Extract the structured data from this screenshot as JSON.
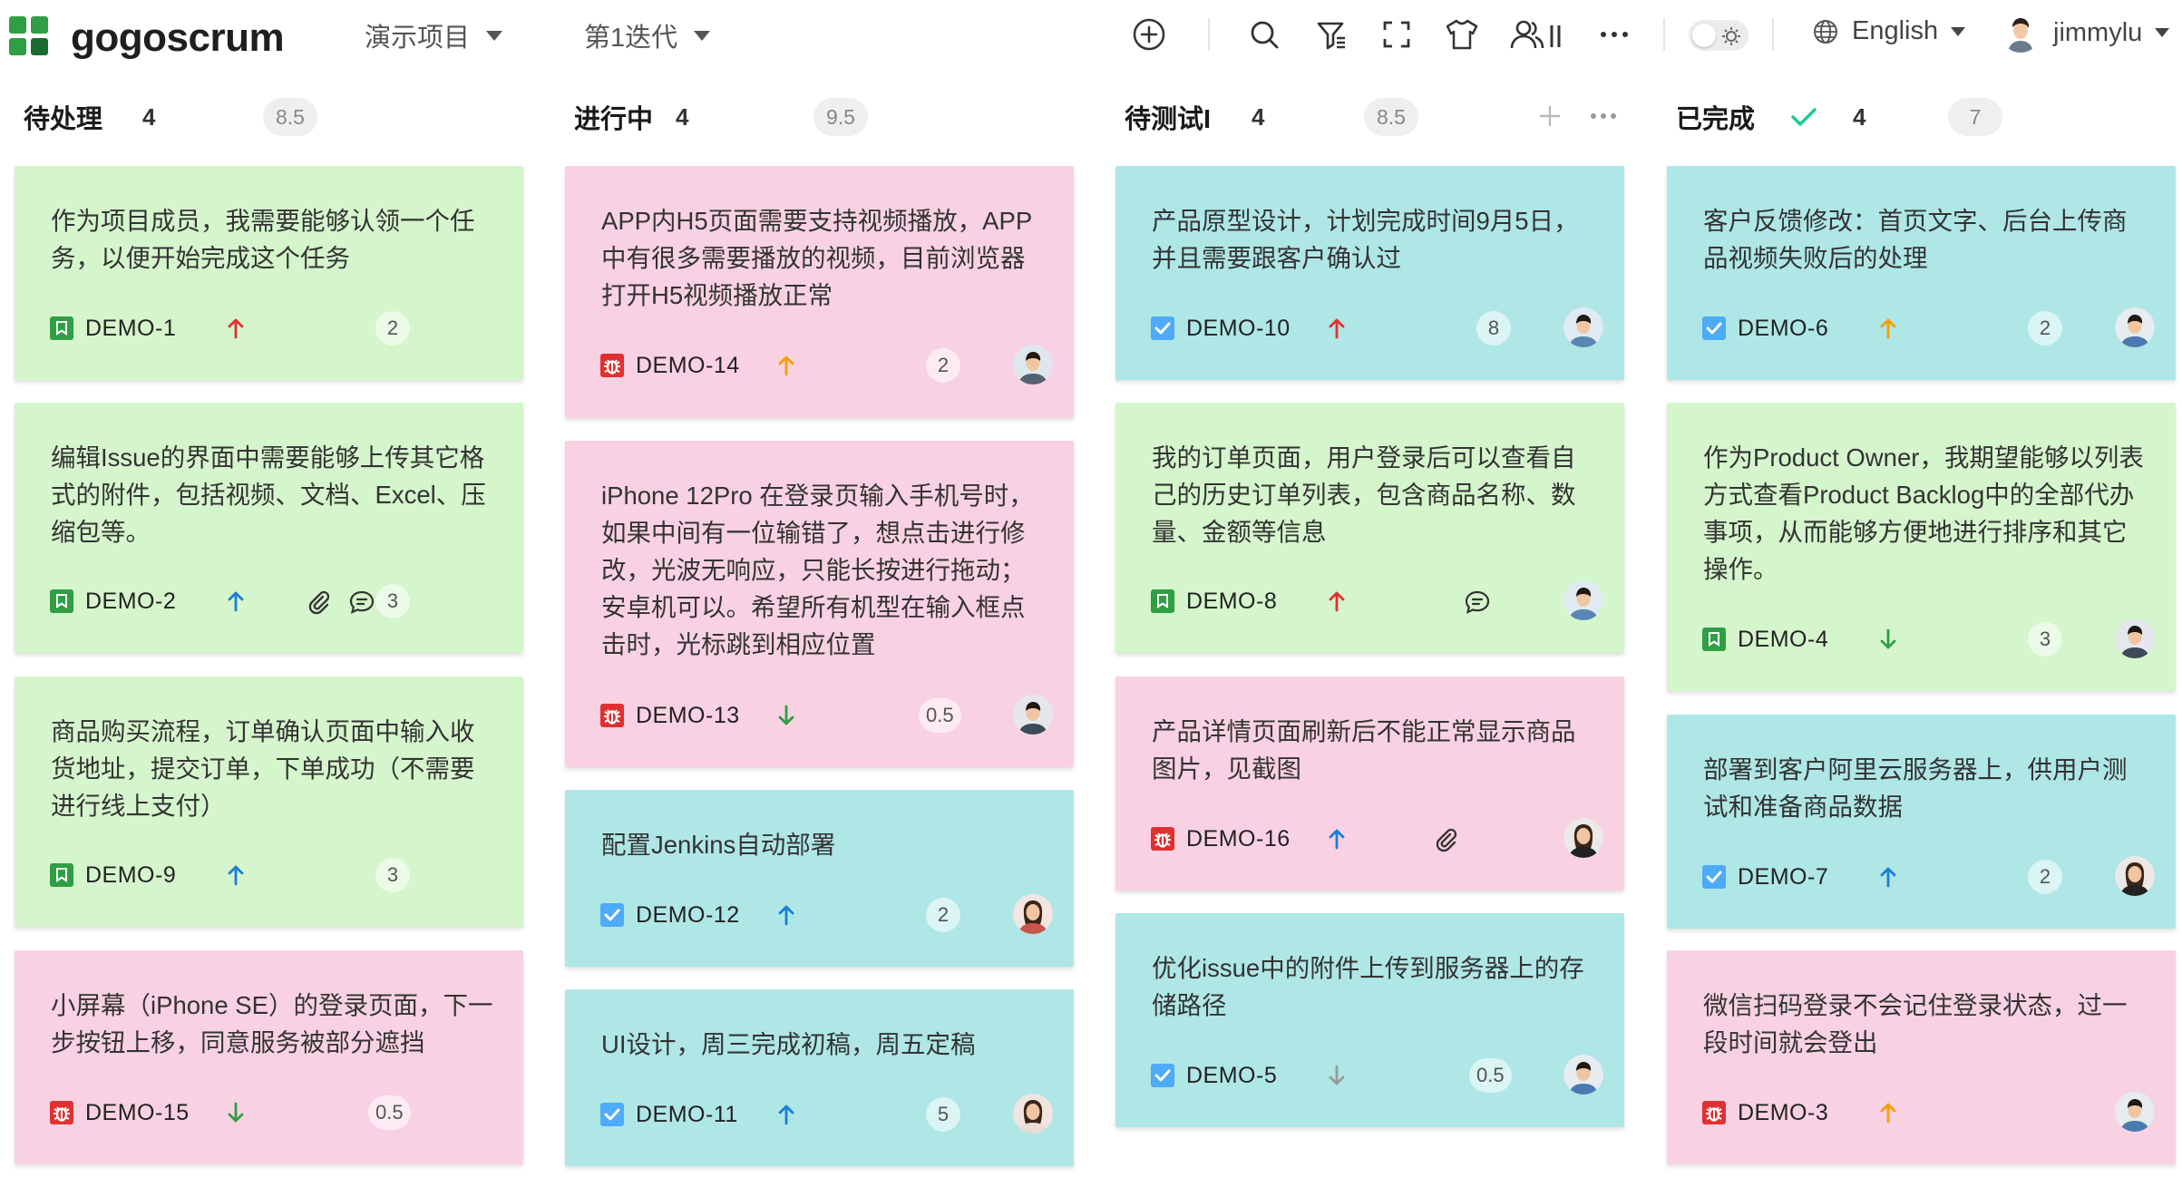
{
  "app": {
    "name": "gogoscrum",
    "project": "演示项目",
    "sprint": "第1迭代",
    "language": "English",
    "username": "jimmylu"
  },
  "colors": {
    "green_card": "#d5f5cc",
    "pink_card": "#f8d2e2",
    "cyan_card": "#afe6e6",
    "story_icon": "#2f9e44",
    "bug_icon": "#e03131",
    "task_icon": "#4dabf7",
    "priority_high": "#e03131",
    "priority_medium": "#f59f00",
    "priority_normal": "#1c7ed6",
    "priority_low": "#2f9e44",
    "priority_lowest": "#999999"
  },
  "columns": [
    {
      "title": "待处理",
      "count": "4",
      "points": "8.5"
    },
    {
      "title": "进行中",
      "count": "4",
      "points": "9.5"
    },
    {
      "title": "待测试I",
      "count": "4",
      "points": "8.5"
    },
    {
      "title": "已完成",
      "count": "4",
      "points": "7"
    }
  ],
  "cards": [
    {
      "title": "作为项目成员，我需要能够认领一个任务，以便开始完成这个任务",
      "key": "DEMO-1",
      "type": "story",
      "priority": "high",
      "points": "2",
      "attachment": false,
      "comment": false,
      "assignee": null
    },
    {
      "title": "编辑Issue的界面中需要能够上传其它格式的附件，包括视频、文档、Excel、压缩包等。",
      "key": "DEMO-2",
      "type": "story",
      "priority": "normal",
      "points": "3",
      "attachment": true,
      "comment": true,
      "assignee": null
    },
    {
      "title": "商品购买流程，订单确认页面中输入收货地址，提交订单，下单成功（不需要进行线上支付）",
      "key": "DEMO-9",
      "type": "story",
      "priority": "normal",
      "points": "3",
      "attachment": false,
      "comment": false,
      "assignee": null
    },
    {
      "title": "小屏幕（iPhone SE）的登录页面，下一步按钮上移，同意服务被部分遮挡",
      "key": "DEMO-15",
      "type": "bug",
      "priority": "low",
      "points": "0.5",
      "attachment": false,
      "comment": false,
      "assignee": null
    },
    {
      "title": "APP内H5页面需要支持视频播放，APP中有很多需要播放的视频，目前浏览器打开H5视频播放正常",
      "key": "DEMO-14",
      "type": "bug",
      "priority": "medium",
      "points": "2",
      "attachment": false,
      "comment": false,
      "assignee": "man1"
    },
    {
      "title": "iPhone 12Pro 在登录页输入手机号时，如果中间有一位输错了，想点击进行修改，光波无响应，只能长按进行拖动；安卓机可以。希望所有机型在输入框点击时，光标跳到相应位置",
      "key": "DEMO-13",
      "type": "bug",
      "priority": "low",
      "points": "0.5",
      "attachment": false,
      "comment": false,
      "assignee": "man2"
    },
    {
      "title": "配置Jenkins自动部署",
      "key": "DEMO-12",
      "type": "task",
      "priority": "normal",
      "points": "2",
      "attachment": false,
      "comment": false,
      "assignee": "woman1"
    },
    {
      "title": "UI设计，周三完成初稿，周五定稿",
      "key": "DEMO-11",
      "type": "task",
      "priority": "normal",
      "points": "5",
      "attachment": false,
      "comment": false,
      "assignee": "woman2"
    },
    {
      "title": "产品原型设计，计划完成时间9月5日，并且需要跟客户确认过",
      "key": "DEMO-10",
      "type": "task",
      "priority": "high",
      "points": "8",
      "attachment": false,
      "comment": false,
      "assignee": "man3"
    },
    {
      "title": "我的订单页面，用户登录后可以查看自己的历史订单列表，包含商品名称、数量、金额等信息",
      "key": "DEMO-8",
      "type": "story",
      "priority": "high",
      "points": "",
      "attachment": false,
      "comment": true,
      "assignee": "man3"
    },
    {
      "title": "产品详情页面刷新后不能正常显示商品图片，见截图",
      "key": "DEMO-16",
      "type": "bug",
      "priority": "normal",
      "points": "",
      "attachment": true,
      "comment": false,
      "assignee": "woman3"
    },
    {
      "title": "优化issue中的附件上传到服务器上的存储路径",
      "key": "DEMO-5",
      "type": "task",
      "priority": "lowest",
      "points": "0.5",
      "attachment": false,
      "comment": false,
      "assignee": "man4"
    },
    {
      "title": "客户反馈修改：首页文字、后台上传商品视频失败后的处理",
      "key": "DEMO-6",
      "type": "task",
      "priority": "medium",
      "points": "2",
      "attachment": false,
      "comment": false,
      "assignee": "man4"
    },
    {
      "title": "作为Product Owner，我期望能够以列表方式查看Product Backlog中的全部代办事项，从而能够方便地进行排序和其它操作。",
      "key": "DEMO-4",
      "type": "story",
      "priority": "low",
      "points": "3",
      "attachment": false,
      "comment": false,
      "assignee": "man2"
    },
    {
      "title": "部署到客户阿里云服务器上，供用户测试和准备商品数据",
      "key": "DEMO-7",
      "type": "task",
      "priority": "normal",
      "points": "2",
      "attachment": false,
      "comment": false,
      "assignee": "woman3"
    },
    {
      "title": "微信扫码登录不会记住登录状态，过一段时间就会登出",
      "key": "DEMO-3",
      "type": "bug",
      "priority": "medium",
      "points": "",
      "attachment": false,
      "comment": false,
      "assignee": "man4"
    }
  ]
}
